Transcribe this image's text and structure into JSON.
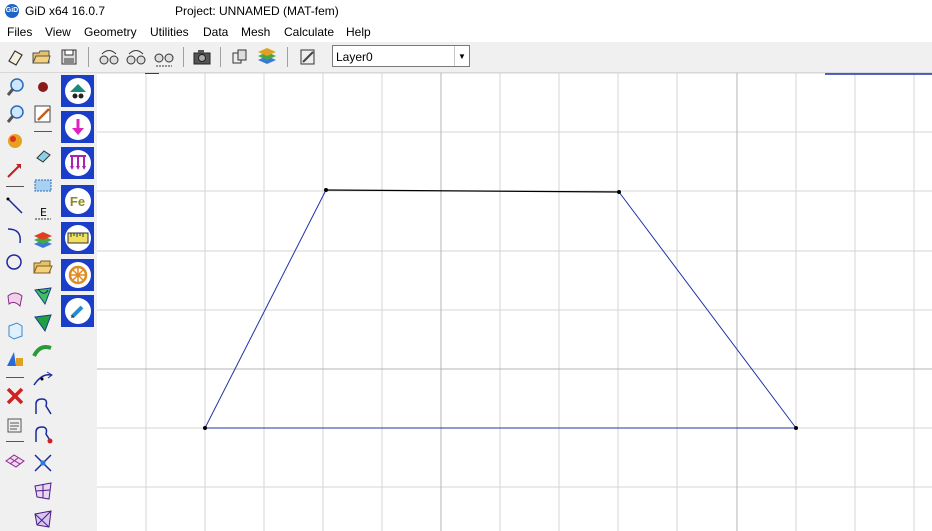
{
  "window": {
    "app_title": "GiD x64 16.0.7",
    "project_title": "Project: UNNAMED (MAT-fem)",
    "logo_text": "GiD"
  },
  "menu": [
    "Files",
    "View",
    "Geometry",
    "Utilities",
    "Data",
    "Mesh",
    "Calculate",
    "Help"
  ],
  "layer": {
    "selected": "Layer0"
  },
  "problemtype_buttons": [
    "Fe"
  ],
  "colors": {
    "accent_blue": "#1a3ec8",
    "line_color": "#2233aa",
    "grid_color": "#d6d6d6",
    "axis_color": "#b4b4b4"
  },
  "icons": {
    "toolbar": [
      "new-file-icon",
      "open-folder-icon",
      "save-icon",
      "undo-icon",
      "redo-icon",
      "zoom-icon",
      "screenshot-icon",
      "layer-view-icon",
      "layers-icon",
      "edit-icon"
    ],
    "left_col1": [
      "zoom-in-icon",
      "zoom-out-icon",
      "render-icon",
      "vector-icon",
      "line-icon",
      "arc-icon",
      "circle-icon",
      "surface-icon",
      "volume-icon",
      "shapes-icon",
      "delete-icon",
      "list-icon",
      "mesh-icon"
    ],
    "left_col2": [
      "point-icon",
      "edit-icon",
      "eraser-icon",
      "select-rect-icon",
      "dimension-icon",
      "layers-icon",
      "folder-icon",
      "surface-create-icon",
      "surface-fill-icon",
      "coons-icon",
      "curve-icon",
      "nurbs-icon",
      "nurbs-edit-icon",
      "intersect-icon",
      "surface-mesh-icon",
      "volume-mesh-icon"
    ],
    "problemtype": [
      "boundary-conditions-icon",
      "point-load-icon",
      "line-load-icon",
      "material-icon",
      "units-icon",
      "calculate-wheel-icon",
      "pencil-icon"
    ]
  }
}
